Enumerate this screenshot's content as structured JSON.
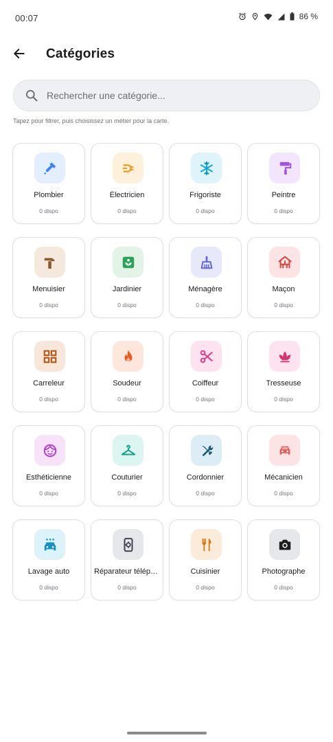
{
  "status": {
    "time": "00:07",
    "battery": "86 %"
  },
  "header": {
    "title": "Catégories"
  },
  "search": {
    "placeholder": "Rechercher une catégorie..."
  },
  "hint": "Tapez pour filtrer, puis choisissez un métier pour la carte.",
  "categories": [
    {
      "name": "Plombier",
      "count": "0 dispo",
      "icon": "plumber-icon",
      "bg": "#e3eefe",
      "fg": "#3b82f6"
    },
    {
      "name": "Électricien",
      "count": "0 dispo",
      "icon": "plug-icon",
      "bg": "#fdf1dc",
      "fg": "#e8a020"
    },
    {
      "name": "Frigoriste",
      "count": "0 dispo",
      "icon": "snowflake-icon",
      "bg": "#dff3fb",
      "fg": "#12a7d8"
    },
    {
      "name": "Peintre",
      "count": "0 dispo",
      "icon": "paint-roller-icon",
      "bg": "#f1e6fd",
      "fg": "#a352e8"
    },
    {
      "name": "Menuisier",
      "count": "0 dispo",
      "icon": "hammer-icon",
      "bg": "#f4e9dc",
      "fg": "#8a5a2b"
    },
    {
      "name": "Jardinier",
      "count": "0 dispo",
      "icon": "plant-icon",
      "bg": "#e1f4e6",
      "fg": "#2aa45a"
    },
    {
      "name": "Ménagère",
      "count": "0 dispo",
      "icon": "broom-icon",
      "bg": "#e8e8fb",
      "fg": "#6366e0"
    },
    {
      "name": "Maçon",
      "count": "0 dispo",
      "icon": "brick-wall-icon",
      "bg": "#fde4e4",
      "fg": "#d9453e"
    },
    {
      "name": "Carreleur",
      "count": "0 dispo",
      "icon": "tiles-icon",
      "bg": "#f7e7da",
      "fg": "#b35c1e"
    },
    {
      "name": "Soudeur",
      "count": "0 dispo",
      "icon": "flame-icon",
      "bg": "#fde7dc",
      "fg": "#ef5a1f"
    },
    {
      "name": "Coiffeur",
      "count": "0 dispo",
      "icon": "scissors-icon",
      "bg": "#fde3ef",
      "fg": "#e43f8e"
    },
    {
      "name": "Tresseuse",
      "count": "0 dispo",
      "icon": "lotus-icon",
      "bg": "#fde3ef",
      "fg": "#d7336e"
    },
    {
      "name": "Esthéticienne",
      "count": "0 dispo",
      "icon": "face-icon",
      "bg": "#f6e3fa",
      "fg": "#b63dd1"
    },
    {
      "name": "Couturier",
      "count": "0 dispo",
      "icon": "hanger-icon",
      "bg": "#dcf5f0",
      "fg": "#14a08a"
    },
    {
      "name": "Cordonnier",
      "count": "0 dispo",
      "icon": "tools-icon",
      "bg": "#dcedf5",
      "fg": "#1d5a78"
    },
    {
      "name": "Mécanicien",
      "count": "0 dispo",
      "icon": "car-icon",
      "bg": "#fde4e4",
      "fg": "#e45a5a"
    },
    {
      "name": "Lavage auto",
      "count": "0 dispo",
      "icon": "car-wash-icon",
      "bg": "#dcf3fa",
      "fg": "#1594c4"
    },
    {
      "name": "Réparateur téléphone",
      "count": "0 dispo",
      "icon": "phone-repair-icon",
      "bg": "#e6e7eb",
      "fg": "#3f4450"
    },
    {
      "name": "Cuisinier",
      "count": "0 dispo",
      "icon": "fork-knife-icon",
      "bg": "#fbecd9",
      "fg": "#d9780f"
    },
    {
      "name": "Photographe",
      "count": "0 dispo",
      "icon": "camera-icon",
      "bg": "#e6e7ea",
      "fg": "#1c1c1e"
    }
  ]
}
